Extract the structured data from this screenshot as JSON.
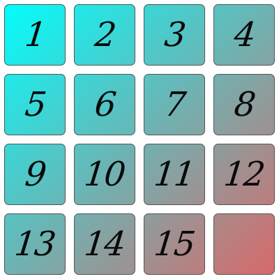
{
  "puzzle": {
    "tiles": [
      "1",
      "2",
      "3",
      "4",
      "5",
      "6",
      "7",
      "8",
      "9",
      "10",
      "11",
      "12",
      "13",
      "14",
      "15",
      ""
    ],
    "empty_index": 15,
    "gradient_start": "#00ffff",
    "gradient_end": "#dd6666"
  }
}
